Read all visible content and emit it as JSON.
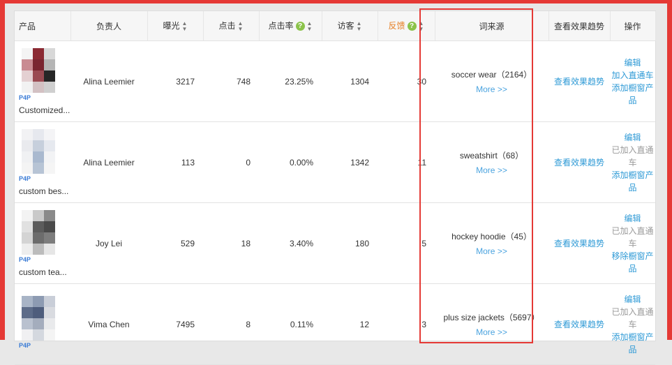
{
  "headers": {
    "product": "产品",
    "owner": "负责人",
    "impressions": "曝光",
    "clicks": "点击",
    "ctr": "点击率",
    "visitors": "访客",
    "feedback": "反馈",
    "keyword_source": "词来源",
    "trend": "查看效果趋势",
    "actions": "操作"
  },
  "rows": [
    {
      "badge": "P4P",
      "name": "Customized...",
      "owner": "Alina Leemier",
      "impressions": "3217",
      "clicks": "748",
      "ctr": "23.25%",
      "visitors": "1304",
      "feedback": "30",
      "keyword": "soccer wear（2164）",
      "more": "More >>",
      "trend": "查看效果趋势",
      "op1": "编辑",
      "op2": "加入直通车",
      "op2_done": false,
      "op3": "添加橱窗产品",
      "thumb_colors": [
        "#f4f4f4",
        "#8b2a33",
        "#d8d8d8",
        "#c98b92",
        "#7a2530",
        "#b5b5b5",
        "#e4d0d2",
        "#9a4a52",
        "#262626",
        "#f2f2f2",
        "#d3c1c3",
        "#cfcfcf"
      ]
    },
    {
      "badge": "P4P",
      "name": "custom bes...",
      "owner": "Alina Leemier",
      "impressions": "113",
      "clicks": "0",
      "ctr": "0.00%",
      "visitors": "1342",
      "feedback": "11",
      "keyword": "sweatshirt（68）",
      "more": "More >>",
      "trend": "查看效果趋势",
      "op1": "编辑",
      "op2": "已加入直通车",
      "op2_done": true,
      "op3": "添加橱窗产品",
      "thumb_colors": [
        "#f2f2f4",
        "#e6e8ee",
        "#f4f4f6",
        "#e9eaee",
        "#c6cfdc",
        "#e6e9ef",
        "#f0f1f3",
        "#a9b9cf",
        "#f2f3f5",
        "#f4f4f4",
        "#b7c4d5",
        "#f5f5f5"
      ]
    },
    {
      "badge": "P4P",
      "name": "custom tea...",
      "owner": "Joy Lei",
      "impressions": "529",
      "clicks": "18",
      "ctr": "3.40%",
      "visitors": "180",
      "feedback": "5",
      "keyword": "hockey hoodie（45）",
      "more": "More >>",
      "trend": "查看效果趋势",
      "op1": "编辑",
      "op2": "已加入直通车",
      "op2_done": true,
      "op3": "移除橱窗产品",
      "thumb_colors": [
        "#f3f3f3",
        "#c9c9c9",
        "#8a8a8a",
        "#e1e1e1",
        "#5c5c5c",
        "#4a4a4a",
        "#d4d4d4",
        "#6c6c6c",
        "#7d7d7d",
        "#eeeeee",
        "#bcbcbc",
        "#e6e6e6"
      ]
    },
    {
      "badge": "P4P",
      "name": "",
      "owner": "Vima Chen",
      "impressions": "7495",
      "clicks": "8",
      "ctr": "0.11%",
      "visitors": "12",
      "feedback": "3",
      "keyword": "plus size jackets（5697）",
      "more": "More >>",
      "trend": "查看效果趋势",
      "op1": "编辑",
      "op2": "已加入直通车",
      "op2_done": true,
      "op3": "添加橱窗产品",
      "thumb_colors": [
        "#a8b4c6",
        "#8d9bb2",
        "#c9ced8",
        "#5d6c89",
        "#4e5d7c",
        "#d9dbe0",
        "#b9c1cf",
        "#a4adbd",
        "#e9eaec",
        "#f0f0f2",
        "#d4d8df",
        "#f4f4f4"
      ]
    }
  ]
}
